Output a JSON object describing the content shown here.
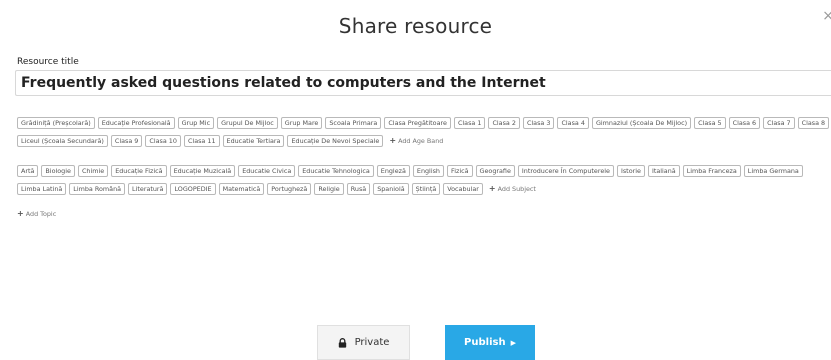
{
  "dialog": {
    "title": "Share resource",
    "close": "×"
  },
  "resource": {
    "label": "Resource title",
    "title": "Frequently asked questions related to computers and the Internet"
  },
  "age_bands": [
    "Grădiniță (Preșcolară)",
    "Educație Profesională",
    "Grup Mic",
    "Grupul De Mijloc",
    "Grup Mare",
    "Scoala Primara",
    "Clasa Pregătitoare",
    "Clasa 1",
    "Clasa 2",
    "Clasa 3",
    "Clasa 4",
    "Gimnaziul (Școala De Mijloc)",
    "Clasa 5",
    "Clasa 6",
    "Clasa 7",
    "Clasa 8",
    "Liceul (Școala Secundară)",
    "Clasa 9",
    "Clasa 10",
    "Clasa 11",
    "Educatie Tertiara",
    "Educație De Nevoi Speciale"
  ],
  "add_age_band": "Add Age Band",
  "subjects": [
    "Artă",
    "Biologie",
    "Chimie",
    "Educație Fizică",
    "Educație Muzicală",
    "Educatie Civica",
    "Educatie Tehnologica",
    "Engleză",
    "English",
    "Fizică",
    "Geografie",
    "Introducere În Computerele",
    "Istorie",
    "Italiană",
    "Limba Franceza",
    "Limba Germana",
    "Limba Latină",
    "Limba Română",
    "Literatură",
    "LOGOPEDIE",
    "Matematică",
    "Portugheză",
    "Religie",
    "Rusă",
    "Spaniolă",
    "Știință",
    "Vocabular"
  ],
  "add_subject": "Add Subject",
  "add_topic": "Add Topic",
  "buttons": {
    "private": "Private",
    "publish": "Publish"
  },
  "colors": {
    "publish_bg": "#29a8e6",
    "private_bg": "#f4f4f4",
    "tag_border": "#b9b9b9"
  }
}
